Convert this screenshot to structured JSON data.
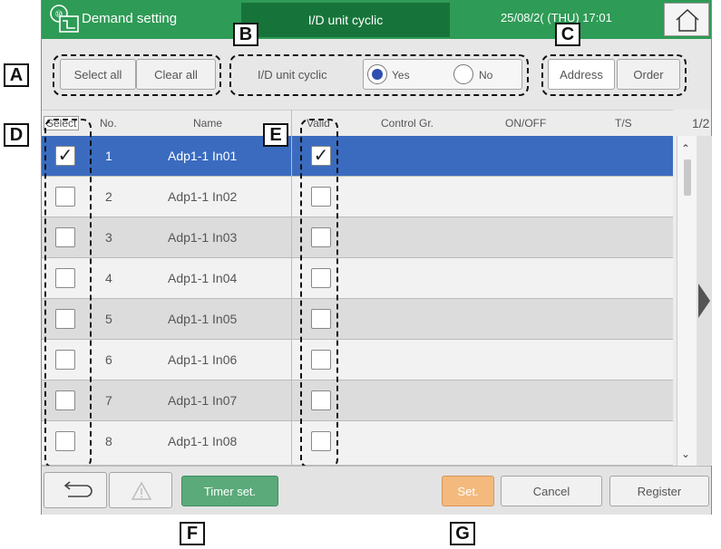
{
  "header": {
    "screen_title": "Demand setting",
    "active_tab": "I/D unit cyclic",
    "datetime": "25/08/2( (THU) 17:01"
  },
  "toolbar": {
    "select_all": "Select all",
    "clear_all": "Clear all",
    "cyclic_label": "I/D unit cyclic",
    "yes": "Yes",
    "no": "No",
    "cyclic_value": "Yes",
    "address": "Address",
    "order": "Order"
  },
  "table": {
    "headers": {
      "select": "Select",
      "no": "No.",
      "name": "Name",
      "valid": "Valid",
      "control_gr": "Control Gr.",
      "onoff": "ON/OFF",
      "ts": "T/S"
    },
    "page": "1/2",
    "rows": [
      {
        "no": "1",
        "name": "Adp1-1 In01",
        "selected": true,
        "valid": true
      },
      {
        "no": "2",
        "name": "Adp1-1 In02",
        "selected": false,
        "valid": false
      },
      {
        "no": "3",
        "name": "Adp1-1 In03",
        "selected": false,
        "valid": false
      },
      {
        "no": "4",
        "name": "Adp1-1 In04",
        "selected": false,
        "valid": false
      },
      {
        "no": "5",
        "name": "Adp1-1 In05",
        "selected": false,
        "valid": false
      },
      {
        "no": "6",
        "name": "Adp1-1 In06",
        "selected": false,
        "valid": false
      },
      {
        "no": "7",
        "name": "Adp1-1 In07",
        "selected": false,
        "valid": false
      },
      {
        "no": "8",
        "name": "Adp1-1 In08",
        "selected": false,
        "valid": false
      }
    ]
  },
  "footer": {
    "timer_set": "Timer set.",
    "set": "Set.",
    "cancel": "Cancel",
    "register": "Register"
  },
  "markers": {
    "a": "A",
    "b": "B",
    "c": "C",
    "d": "D",
    "e": "E",
    "f": "F",
    "g": "G"
  },
  "icons": {
    "home": "home-icon",
    "back": "back-icon",
    "warning": "warning-icon",
    "app": "demand-icon",
    "page_next": "triangle-right-icon"
  },
  "colors": {
    "header": "#2e9b56",
    "active_tab": "#16743a",
    "selected_row": "#3a6bbf",
    "timer_btn": "#5aaa7a",
    "set_btn": "#f4b97d"
  }
}
